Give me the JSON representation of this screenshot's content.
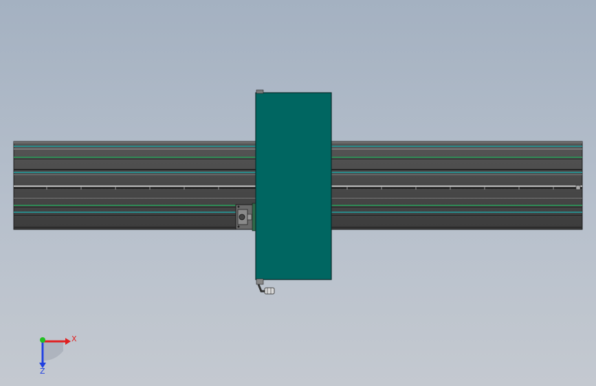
{
  "viewport": {
    "background_top": "#a4b1c1",
    "background_bottom": "#c4c9d0"
  },
  "model": {
    "rail_color": "#4a4a4a",
    "rail_dark": "#2e2e2e",
    "rail_accent_green": "#2f8a55",
    "rail_accent_teal": "#2a8a8a",
    "carriage_color": "#006661",
    "carriage_edge": "#0a2b2a",
    "motor_color": "#5a5a5a",
    "fitting_color": "#d9d9d9"
  },
  "triad": {
    "x_label": "X",
    "z_label": "Z",
    "x_color": "#e02020",
    "y_color": "#22c022",
    "z_color": "#2040e0"
  }
}
